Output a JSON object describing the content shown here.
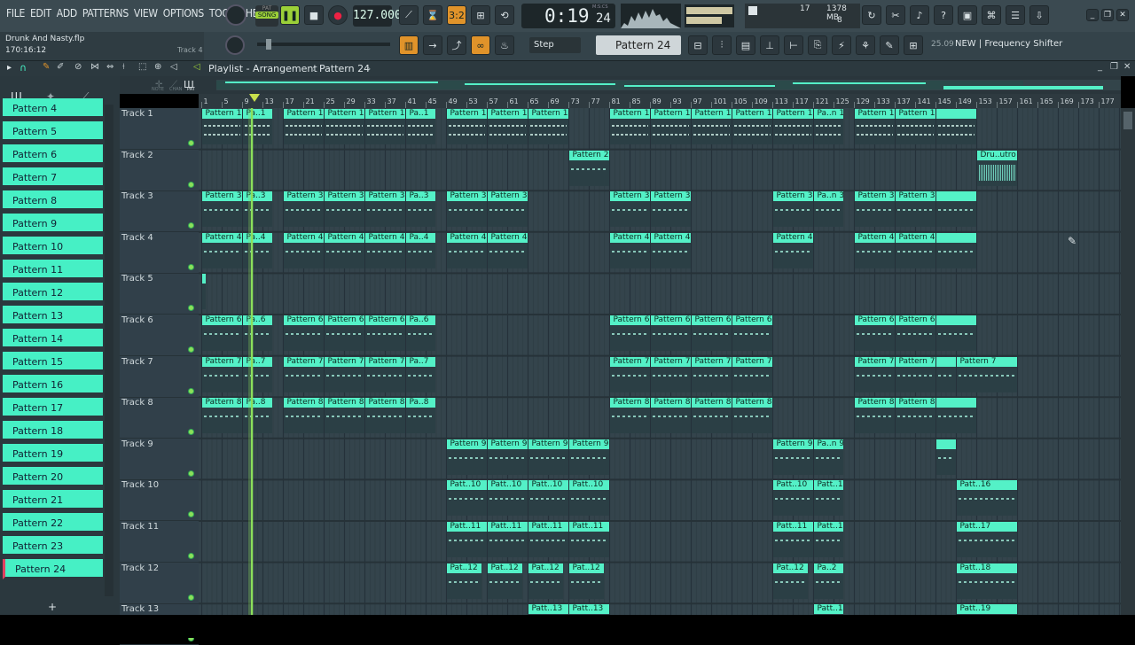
{
  "menu": [
    "FILE",
    "EDIT",
    "ADD",
    "PATTERNS",
    "VIEW",
    "OPTIONS",
    "TOOLS",
    "HELP"
  ],
  "transport": {
    "mode_pat": "PAT",
    "mode_song": "SONG",
    "tempo": "127.000",
    "time": "0:19",
    "time_sub": "24",
    "time_label": "M:S:CS"
  },
  "meters": {
    "value1": "17",
    "mem": "1378 MB",
    "value2": "8"
  },
  "project": {
    "name": "Drunk And Nasty.flp",
    "position": "170:16:12",
    "target": "Track 4"
  },
  "toolbar2": {
    "snap": "Step",
    "pattern": "Pattern 24",
    "hint_num": "25.09",
    "hint_text": "NEW | Frequency Shifter"
  },
  "playlist": {
    "title": "Playlist - Arrangement",
    "pattern": "Pattern 24",
    "col_labels": [
      "NOTE",
      "CHAN",
      "PAT"
    ]
  },
  "ruler": [
    "1",
    "5",
    "9",
    "13",
    "17",
    "21",
    "25",
    "29",
    "33",
    "37",
    "41",
    "45",
    "49",
    "53",
    "57",
    "61",
    "65",
    "69",
    "73",
    "77",
    "81",
    "85",
    "89",
    "93",
    "97",
    "101",
    "105",
    "109",
    "113",
    "117",
    "121",
    "125",
    "129",
    "133",
    "137",
    "141",
    "145",
    "149",
    "153",
    "157",
    "161",
    "165",
    "169",
    "173",
    "177"
  ],
  "patterns": [
    "Pattern 4",
    "Pattern 5",
    "Pattern 6",
    "Pattern 7",
    "Pattern 8",
    "Pattern 9",
    "Pattern 10",
    "Pattern 11",
    "Pattern 12",
    "Pattern 13",
    "Pattern 14",
    "Pattern 15",
    "Pattern 16",
    "Pattern 17",
    "Pattern 18",
    "Pattern 19",
    "Pattern 20",
    "Pattern 21",
    "Pattern 22",
    "Pattern 23",
    "Pattern 24"
  ],
  "tracks": [
    "Track 1",
    "Track 2",
    "Track 3",
    "Track 4",
    "Track 5",
    "Track 6",
    "Track 7",
    "Track 8",
    "Track 9",
    "Track 10",
    "Track 11",
    "Track 12",
    "Track 13"
  ],
  "clips": [
    {
      "t": 0,
      "s": 1,
      "e": 9,
      "l": "Pattern 1"
    },
    {
      "t": 0,
      "s": 9,
      "e": 15,
      "l": "Pa..1"
    },
    {
      "t": 0,
      "s": 17,
      "e": 25,
      "l": "Pattern 1"
    },
    {
      "t": 0,
      "s": 25,
      "e": 33,
      "l": "Pattern 1"
    },
    {
      "t": 0,
      "s": 33,
      "e": 41,
      "l": "Pattern 1"
    },
    {
      "t": 0,
      "s": 41,
      "e": 47,
      "l": "Pa..1"
    },
    {
      "t": 0,
      "s": 49,
      "e": 57,
      "l": "Pattern 1"
    },
    {
      "t": 0,
      "s": 57,
      "e": 65,
      "l": "Pattern 1"
    },
    {
      "t": 0,
      "s": 65,
      "e": 73,
      "l": "Pattern 1"
    },
    {
      "t": 0,
      "s": 81,
      "e": 89,
      "l": "Pattern 1"
    },
    {
      "t": 0,
      "s": 89,
      "e": 97,
      "l": "Pattern 1"
    },
    {
      "t": 0,
      "s": 97,
      "e": 105,
      "l": "Pattern 1"
    },
    {
      "t": 0,
      "s": 105,
      "e": 113,
      "l": "Pattern 1"
    },
    {
      "t": 0,
      "s": 113,
      "e": 121,
      "l": "Pattern 1"
    },
    {
      "t": 0,
      "s": 121,
      "e": 127,
      "l": "Pa..n 1"
    },
    {
      "t": 0,
      "s": 129,
      "e": 137,
      "l": "Pattern 1"
    },
    {
      "t": 0,
      "s": 137,
      "e": 145,
      "l": "Pattern 1"
    },
    {
      "t": 0,
      "s": 145,
      "e": 153,
      "l": ""
    },
    {
      "t": 1,
      "s": 73,
      "e": 81,
      "l": "Pattern 2"
    },
    {
      "t": 1,
      "s": 153,
      "e": 161,
      "l": "Dru..utro"
    },
    {
      "t": 2,
      "s": 1,
      "e": 9,
      "l": "Pattern 3"
    },
    {
      "t": 2,
      "s": 9,
      "e": 15,
      "l": "Pa..3"
    },
    {
      "t": 2,
      "s": 17,
      "e": 25,
      "l": "Pattern 3"
    },
    {
      "t": 2,
      "s": 25,
      "e": 33,
      "l": "Pattern 3"
    },
    {
      "t": 2,
      "s": 33,
      "e": 41,
      "l": "Pattern 3"
    },
    {
      "t": 2,
      "s": 41,
      "e": 47,
      "l": "Pa..3"
    },
    {
      "t": 2,
      "s": 49,
      "e": 57,
      "l": "Pattern 3"
    },
    {
      "t": 2,
      "s": 57,
      "e": 65,
      "l": "Pattern 3"
    },
    {
      "t": 2,
      "s": 81,
      "e": 89,
      "l": "Pattern 3"
    },
    {
      "t": 2,
      "s": 89,
      "e": 97,
      "l": "Pattern 3"
    },
    {
      "t": 2,
      "s": 113,
      "e": 121,
      "l": "Pattern 3"
    },
    {
      "t": 2,
      "s": 121,
      "e": 127,
      "l": "Pa..n 3"
    },
    {
      "t": 2,
      "s": 129,
      "e": 137,
      "l": "Pattern 3"
    },
    {
      "t": 2,
      "s": 137,
      "e": 145,
      "l": "Pattern 3"
    },
    {
      "t": 2,
      "s": 145,
      "e": 153,
      "l": ""
    },
    {
      "t": 3,
      "s": 1,
      "e": 9,
      "l": "Pattern 4"
    },
    {
      "t": 3,
      "s": 9,
      "e": 15,
      "l": "Pa..4"
    },
    {
      "t": 3,
      "s": 17,
      "e": 25,
      "l": "Pattern 4"
    },
    {
      "t": 3,
      "s": 25,
      "e": 33,
      "l": "Pattern 4"
    },
    {
      "t": 3,
      "s": 33,
      "e": 41,
      "l": "Pattern 4"
    },
    {
      "t": 3,
      "s": 41,
      "e": 47,
      "l": "Pa..4"
    },
    {
      "t": 3,
      "s": 49,
      "e": 57,
      "l": "Pattern 4"
    },
    {
      "t": 3,
      "s": 57,
      "e": 65,
      "l": "Pattern 4"
    },
    {
      "t": 3,
      "s": 81,
      "e": 89,
      "l": "Pattern 4"
    },
    {
      "t": 3,
      "s": 89,
      "e": 97,
      "l": "Pattern 4"
    },
    {
      "t": 3,
      "s": 113,
      "e": 121,
      "l": "Pattern 4"
    },
    {
      "t": 3,
      "s": 129,
      "e": 137,
      "l": "Pattern 4"
    },
    {
      "t": 3,
      "s": 137,
      "e": 145,
      "l": "Pattern 4"
    },
    {
      "t": 3,
      "s": 145,
      "e": 153,
      "l": ""
    },
    {
      "t": 4,
      "s": 1,
      "e": 2,
      "l": ""
    },
    {
      "t": 5,
      "s": 1,
      "e": 9,
      "l": "Pattern 6"
    },
    {
      "t": 5,
      "s": 9,
      "e": 15,
      "l": "Pa..6"
    },
    {
      "t": 5,
      "s": 17,
      "e": 25,
      "l": "Pattern 6"
    },
    {
      "t": 5,
      "s": 25,
      "e": 33,
      "l": "Pattern 6"
    },
    {
      "t": 5,
      "s": 33,
      "e": 41,
      "l": "Pattern 6"
    },
    {
      "t": 5,
      "s": 41,
      "e": 47,
      "l": "Pa..6"
    },
    {
      "t": 5,
      "s": 81,
      "e": 89,
      "l": "Pattern 6"
    },
    {
      "t": 5,
      "s": 89,
      "e": 97,
      "l": "Pattern 6"
    },
    {
      "t": 5,
      "s": 97,
      "e": 105,
      "l": "Pattern 6"
    },
    {
      "t": 5,
      "s": 105,
      "e": 113,
      "l": "Pattern 6"
    },
    {
      "t": 5,
      "s": 129,
      "e": 137,
      "l": "Pattern 6"
    },
    {
      "t": 5,
      "s": 137,
      "e": 145,
      "l": "Pattern 6"
    },
    {
      "t": 5,
      "s": 145,
      "e": 153,
      "l": ""
    },
    {
      "t": 6,
      "s": 1,
      "e": 9,
      "l": "Pattern 7"
    },
    {
      "t": 6,
      "s": 9,
      "e": 15,
      "l": "Pa..7"
    },
    {
      "t": 6,
      "s": 17,
      "e": 25,
      "l": "Pattern 7"
    },
    {
      "t": 6,
      "s": 25,
      "e": 33,
      "l": "Pattern 7"
    },
    {
      "t": 6,
      "s": 33,
      "e": 41,
      "l": "Pattern 7"
    },
    {
      "t": 6,
      "s": 41,
      "e": 47,
      "l": "Pa..7"
    },
    {
      "t": 6,
      "s": 81,
      "e": 89,
      "l": "Pattern 7"
    },
    {
      "t": 6,
      "s": 89,
      "e": 97,
      "l": "Pattern 7"
    },
    {
      "t": 6,
      "s": 97,
      "e": 105,
      "l": "Pattern 7"
    },
    {
      "t": 6,
      "s": 105,
      "e": 113,
      "l": "Pattern 7"
    },
    {
      "t": 6,
      "s": 129,
      "e": 137,
      "l": "Pattern 7"
    },
    {
      "t": 6,
      "s": 137,
      "e": 145,
      "l": "Pattern 7"
    },
    {
      "t": 6,
      "s": 145,
      "e": 149,
      "l": ""
    },
    {
      "t": 6,
      "s": 149,
      "e": 161,
      "l": "Pattern 7"
    },
    {
      "t": 7,
      "s": 1,
      "e": 9,
      "l": "Pattern 8"
    },
    {
      "t": 7,
      "s": 9,
      "e": 15,
      "l": "Pa..8"
    },
    {
      "t": 7,
      "s": 17,
      "e": 25,
      "l": "Pattern 8"
    },
    {
      "t": 7,
      "s": 25,
      "e": 33,
      "l": "Pattern 8"
    },
    {
      "t": 7,
      "s": 33,
      "e": 41,
      "l": "Pattern 8"
    },
    {
      "t": 7,
      "s": 41,
      "e": 47,
      "l": "Pa..8"
    },
    {
      "t": 7,
      "s": 81,
      "e": 89,
      "l": "Pattern 8"
    },
    {
      "t": 7,
      "s": 89,
      "e": 97,
      "l": "Pattern 8"
    },
    {
      "t": 7,
      "s": 97,
      "e": 105,
      "l": "Pattern 8"
    },
    {
      "t": 7,
      "s": 105,
      "e": 113,
      "l": "Pattern 8"
    },
    {
      "t": 7,
      "s": 129,
      "e": 137,
      "l": "Pattern 8"
    },
    {
      "t": 7,
      "s": 137,
      "e": 145,
      "l": "Pattern 8"
    },
    {
      "t": 7,
      "s": 145,
      "e": 153,
      "l": ""
    },
    {
      "t": 8,
      "s": 49,
      "e": 57,
      "l": "Pattern 9"
    },
    {
      "t": 8,
      "s": 57,
      "e": 65,
      "l": "Pattern 9"
    },
    {
      "t": 8,
      "s": 65,
      "e": 73,
      "l": "Pattern 9"
    },
    {
      "t": 8,
      "s": 73,
      "e": 81,
      "l": "Pattern 9"
    },
    {
      "t": 8,
      "s": 113,
      "e": 121,
      "l": "Pattern 9"
    },
    {
      "t": 8,
      "s": 121,
      "e": 127,
      "l": "Pa..n 9"
    },
    {
      "t": 8,
      "s": 145,
      "e": 149,
      "l": ""
    },
    {
      "t": 9,
      "s": 49,
      "e": 57,
      "l": "Patt..10"
    },
    {
      "t": 9,
      "s": 57,
      "e": 65,
      "l": "Patt..10"
    },
    {
      "t": 9,
      "s": 65,
      "e": 73,
      "l": "Patt..10"
    },
    {
      "t": 9,
      "s": 73,
      "e": 81,
      "l": "Patt..10"
    },
    {
      "t": 9,
      "s": 113,
      "e": 121,
      "l": "Patt..10"
    },
    {
      "t": 9,
      "s": 121,
      "e": 127,
      "l": "Patt..10"
    },
    {
      "t": 9,
      "s": 149,
      "e": 161,
      "l": "Patt..16"
    },
    {
      "t": 10,
      "s": 49,
      "e": 57,
      "l": "Patt..11"
    },
    {
      "t": 10,
      "s": 57,
      "e": 65,
      "l": "Patt..11"
    },
    {
      "t": 10,
      "s": 65,
      "e": 73,
      "l": "Patt..11"
    },
    {
      "t": 10,
      "s": 73,
      "e": 81,
      "l": "Patt..11"
    },
    {
      "t": 10,
      "s": 113,
      "e": 121,
      "l": "Patt..11"
    },
    {
      "t": 10,
      "s": 121,
      "e": 127,
      "l": "Patt..11"
    },
    {
      "t": 10,
      "s": 149,
      "e": 161,
      "l": "Patt..17"
    },
    {
      "t": 11,
      "s": 49,
      "e": 56,
      "l": "Pat..12"
    },
    {
      "t": 11,
      "s": 57,
      "e": 64,
      "l": "Pat..12"
    },
    {
      "t": 11,
      "s": 65,
      "e": 72,
      "l": "Pat..12"
    },
    {
      "t": 11,
      "s": 73,
      "e": 80,
      "l": "Pat..12"
    },
    {
      "t": 11,
      "s": 113,
      "e": 120,
      "l": "Pat..12"
    },
    {
      "t": 11,
      "s": 121,
      "e": 127,
      "l": "Pa..2"
    },
    {
      "t": 11,
      "s": 149,
      "e": 161,
      "l": "Patt..18"
    },
    {
      "t": 12,
      "s": 65,
      "e": 73,
      "l": "Patt..13"
    },
    {
      "t": 12,
      "s": 73,
      "e": 81,
      "l": "Patt..13"
    },
    {
      "t": 12,
      "s": 121,
      "e": 127,
      "l": "Patt..13"
    },
    {
      "t": 12,
      "s": 149,
      "e": 161,
      "l": "Patt..19"
    }
  ],
  "colors": {
    "clip": "#54f1c7",
    "pattern_item": "#46f0c5",
    "grid_bg": "#34444c",
    "playhead": "#8be05b"
  }
}
